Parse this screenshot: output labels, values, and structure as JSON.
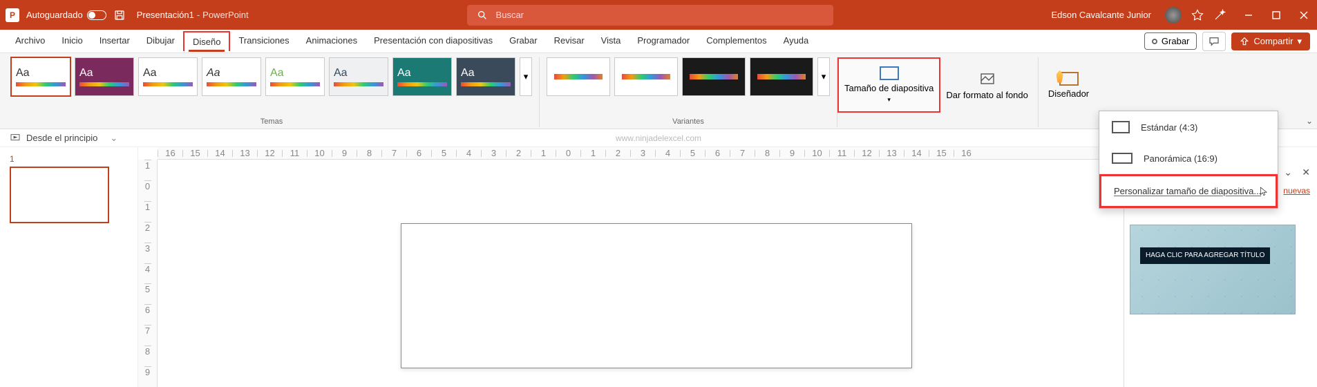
{
  "title_bar": {
    "autosave_label": "Autoguardado",
    "doc_name": "Presentación1",
    "app_name": "PowerPoint",
    "search_placeholder": "Buscar",
    "user_name": "Edson Cavalcante Junior"
  },
  "tabs": {
    "items": [
      "Archivo",
      "Inicio",
      "Insertar",
      "Dibujar",
      "Diseño",
      "Transiciones",
      "Animaciones",
      "Presentación con diapositivas",
      "Grabar",
      "Revisar",
      "Vista",
      "Programador",
      "Complementos",
      "Ayuda"
    ],
    "active_index": 4,
    "record_label": "Grabar",
    "share_label": "Compartir"
  },
  "ribbon": {
    "themes_label": "Temas",
    "variants_label": "Variantes",
    "slide_size_label": "Tamaño de diapositiva",
    "format_bg_label": "Dar formato al fondo",
    "designer_label": "Diseñador"
  },
  "mini_bar": {
    "from_beginning": "Desde el principio",
    "watermark": "www.ninjadelexcel.com"
  },
  "slide_nav": {
    "current": "1"
  },
  "ruler_h": [
    "16",
    "15",
    "14",
    "13",
    "12",
    "11",
    "10",
    "9",
    "8",
    "7",
    "6",
    "5",
    "4",
    "3",
    "2",
    "1",
    "0",
    "1",
    "2",
    "3",
    "4",
    "5",
    "6",
    "7",
    "8",
    "9",
    "10",
    "11",
    "12",
    "13",
    "14",
    "15",
    "16"
  ],
  "ruler_v": [
    "1",
    "0",
    "1",
    "2",
    "3",
    "4",
    "5",
    "6",
    "7",
    "8",
    "9"
  ],
  "dropdown": {
    "standard": "Estándar (4:3)",
    "widescreen": "Panorámica (16:9)",
    "custom": "Personalizar tamaño de diapositiva..."
  },
  "designer_pane": {
    "link": "nuevas",
    "card_title": "HAGA CLIC PARA AGREGAR TÍTULO"
  },
  "colors": {
    "brand": "#c43e1c",
    "highlight": "#e33"
  }
}
